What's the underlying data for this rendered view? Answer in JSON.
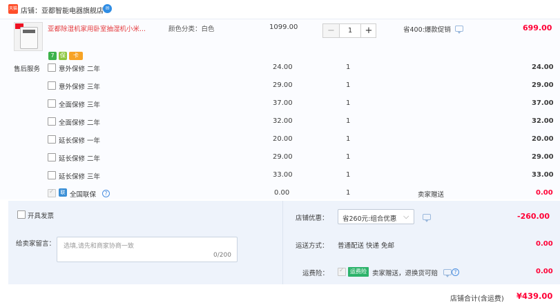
{
  "shop": {
    "tag": "天猫",
    "name": "店铺：亚都智能电器旗舰店",
    "wangwang_icon": "chat-bubble-icon"
  },
  "item": {
    "title": "亚都除湿机家用卧室抽湿机小米...",
    "sku": "颜色分类：白色",
    "price": "1099.00",
    "qty": "1",
    "qty_minus": "−",
    "qty_plus": "+",
    "promo": "省400:爆款促销",
    "subtotal": "699.00",
    "service_icons": [
      "7-day-return-icon",
      "guarantee-icon",
      "card-icon"
    ],
    "service_icon_texts": [
      "7",
      "保",
      "卡"
    ]
  },
  "after_sales": {
    "label": "售后服务",
    "options": [
      {
        "name": "意外保修 二年",
        "price": "24.00",
        "qty": "1",
        "total": "24.00"
      },
      {
        "name": "意外保修 三年",
        "price": "29.00",
        "qty": "1",
        "total": "29.00"
      },
      {
        "name": "全面保修 三年",
        "price": "37.00",
        "qty": "1",
        "total": "37.00"
      },
      {
        "name": "全面保修 二年",
        "price": "32.00",
        "qty": "1",
        "total": "32.00"
      },
      {
        "name": "延长保修 一年",
        "price": "20.00",
        "qty": "1",
        "total": "20.00"
      },
      {
        "name": "延长保修 二年",
        "price": "29.00",
        "qty": "1",
        "total": "29.00"
      },
      {
        "name": "延长保修 三年",
        "price": "33.00",
        "qty": "1",
        "total": "33.00"
      }
    ],
    "national_warranty": {
      "badge": "联",
      "name": "全国联保",
      "price": "0.00",
      "qty": "1",
      "gift": "卖家赠送",
      "total": "0.00"
    }
  },
  "invoice": {
    "label": "开具发票"
  },
  "message": {
    "label": "给卖家留言：",
    "placeholder": "选填,请先和商家协商一致",
    "counter": "0/200"
  },
  "shop_discount": {
    "label": "店铺优惠：",
    "selected": "省260元:组合优惠",
    "amount": "-260.00"
  },
  "shipping": {
    "label": "运送方式：",
    "value": "普通配送 快递 免邮",
    "amount": "0.00"
  },
  "insurance": {
    "label": "运费险：",
    "badge": "运费险",
    "desc": "卖家赠送，退换货可赔",
    "amount": "0.00"
  },
  "total": {
    "label": "店铺合计(含运费)",
    "value": "¥439.00"
  },
  "colors": {
    "price_red": "#ff0036",
    "panel_bg": "#eef3fb",
    "item_bg": "#fbfcff",
    "link_blue": "#4a8ee0",
    "insurance_green": "#2db36b"
  }
}
